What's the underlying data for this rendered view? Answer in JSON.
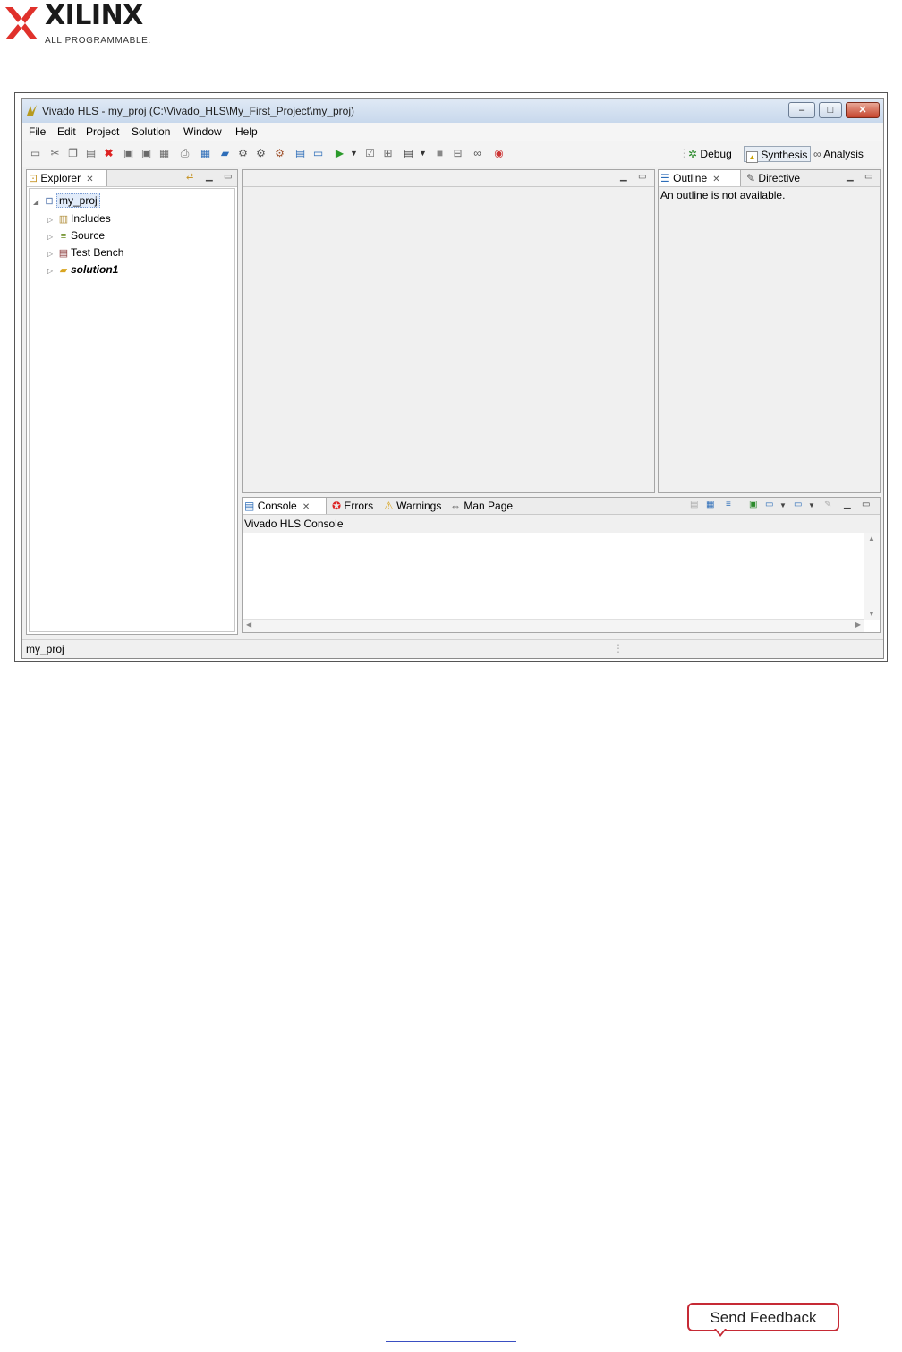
{
  "logo": {
    "wordmark": "XILINX",
    "tagline": "ALL PROGRAMMABLE."
  },
  "window": {
    "title": "Vivado HLS - my_proj (C:\\Vivado_HLS\\My_First_Project\\my_proj)",
    "controls": {
      "minimize": "–",
      "maximize": "□",
      "close": "✕"
    },
    "menu": [
      "File",
      "Edit",
      "Project",
      "Solution",
      "Window",
      "Help"
    ],
    "perspectives": {
      "debug": "Debug",
      "synthesis": "Synthesis",
      "analysis": "Analysis"
    },
    "explorer": {
      "tab": "Explorer",
      "tree": [
        {
          "label": "my_proj",
          "icon": "project-icon"
        },
        {
          "label": "Includes",
          "icon": "includes-icon"
        },
        {
          "label": "Source",
          "icon": "source-icon"
        },
        {
          "label": "Test Bench",
          "icon": "testbench-icon"
        },
        {
          "label": "solution1",
          "icon": "folder-icon"
        }
      ]
    },
    "outline": {
      "tabs": [
        "Outline",
        "Directive"
      ],
      "message": "An outline is not available."
    },
    "console": {
      "tabs": [
        "Console",
        "Errors",
        "Warnings",
        "Man Page"
      ],
      "title": "Vivado HLS Console"
    },
    "status": {
      "left": "my_proj"
    }
  },
  "footer": {
    "feedback_button": "Send Feedback"
  },
  "colors": {
    "accent_red": "#c62a35",
    "logo_red": "#e0312b"
  }
}
